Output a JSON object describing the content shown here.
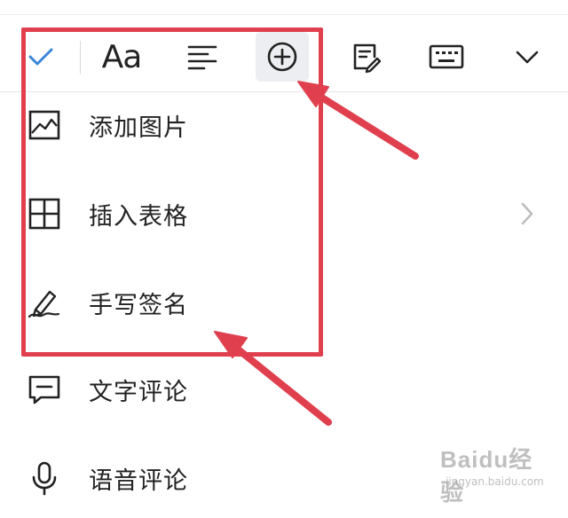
{
  "toolbar": {
    "buttons": [
      {
        "name": "confirm",
        "icon": "check-icon"
      },
      {
        "name": "font",
        "icon": "font-aa-icon",
        "label": "Aa"
      },
      {
        "name": "align",
        "icon": "align-left-icon"
      },
      {
        "name": "insert",
        "icon": "plus-circle-icon",
        "active": true
      },
      {
        "name": "notes",
        "icon": "note-edit-icon"
      },
      {
        "name": "keyboard",
        "icon": "keyboard-icon"
      },
      {
        "name": "collapse",
        "icon": "chevron-down-icon"
      }
    ]
  },
  "menu": {
    "items": [
      {
        "label": "添加图片",
        "icon": "image-icon"
      },
      {
        "label": "插入表格",
        "icon": "table-icon",
        "has_submenu": true
      },
      {
        "label": "手写签名",
        "icon": "signature-pen-icon"
      },
      {
        "label": "文字评论",
        "icon": "text-comment-icon"
      },
      {
        "label": "语音评论",
        "icon": "microphone-icon"
      }
    ]
  },
  "watermark": {
    "brand": "Baidu经验",
    "sub": "jingyan.baidu.com"
  },
  "colors": {
    "accent": "#3a86d6",
    "icon": "#222222",
    "highlight": "#e0404e",
    "active_bg": "#eceef1"
  }
}
